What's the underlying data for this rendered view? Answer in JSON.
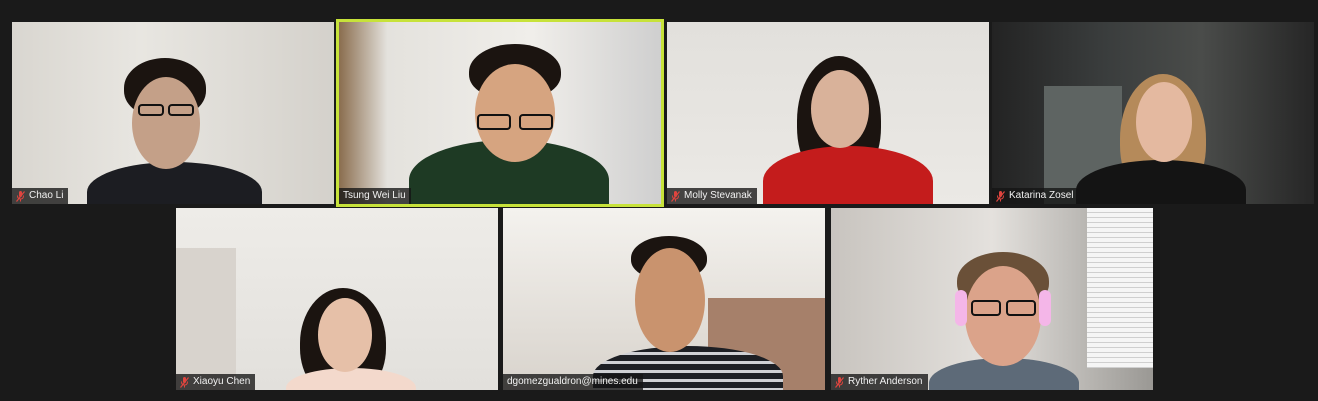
{
  "participants": [
    {
      "name": "Chao Li",
      "muted": true
    },
    {
      "name": "Tsung Wei Liu",
      "muted": false,
      "speaking": true
    },
    {
      "name": "Molly Stevanak",
      "muted": true
    },
    {
      "name": "Katarina Zosel",
      "muted": true
    },
    {
      "name": "Xiaoyu Chen",
      "muted": true
    },
    {
      "name": "dgomezgualdron@mines.edu",
      "muted": false
    },
    {
      "name": "Ryther Anderson",
      "muted": true
    }
  ],
  "colors": {
    "background": "#1a1a1a",
    "active_speaker_border": "#c7e23a",
    "muted_icon": "#e0443e"
  },
  "icons": {
    "muted": "microphone-muted-icon"
  }
}
